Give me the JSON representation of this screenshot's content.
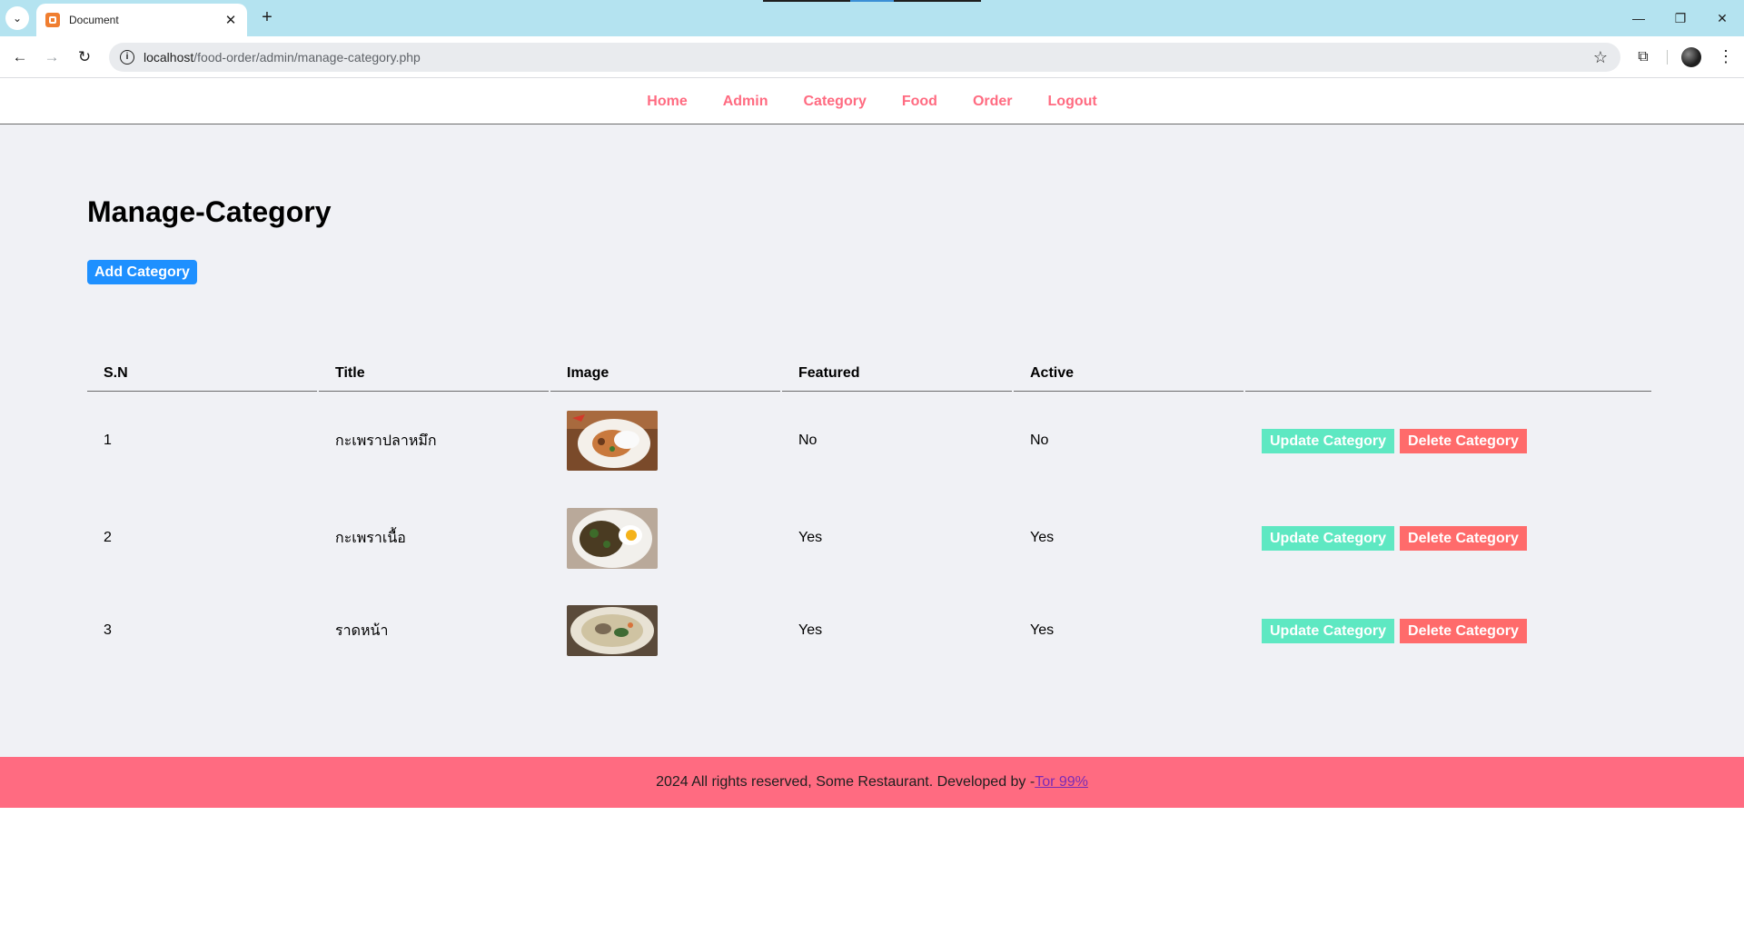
{
  "browser": {
    "tab_title": "Document",
    "url_host": "localhost",
    "url_path": "/food-order/admin/manage-category.php"
  },
  "nav": {
    "items": [
      "Home",
      "Admin",
      "Category",
      "Food",
      "Order",
      "Logout"
    ]
  },
  "main": {
    "title": "Manage-Category",
    "add_button": "Add Category"
  },
  "table": {
    "headers": [
      "S.N",
      "Title",
      "Image",
      "Featured",
      "Active",
      ""
    ],
    "rows": [
      {
        "sn": "1",
        "title": "กะเพราปลาหมึก",
        "featured": "No",
        "active": "No",
        "update": "Update Category",
        "delete": "Delete Category"
      },
      {
        "sn": "2",
        "title": "กะเพราเนื้อ",
        "featured": "Yes",
        "active": "Yes",
        "update": "Update Category",
        "delete": "Delete Category"
      },
      {
        "sn": "3",
        "title": "ราดหน้า",
        "featured": "Yes",
        "active": "Yes",
        "update": "Update Category",
        "delete": "Delete Category"
      }
    ]
  },
  "footer": {
    "text": "2024 All rights reserved, Some Restaurant. Developed by -",
    "link": "Tor 99%"
  },
  "colors": {
    "accent_pink": "#ff6b81",
    "add_blue": "#1e90ff",
    "update_green": "#5ee8c2",
    "delete_red": "#ff6b6b"
  }
}
